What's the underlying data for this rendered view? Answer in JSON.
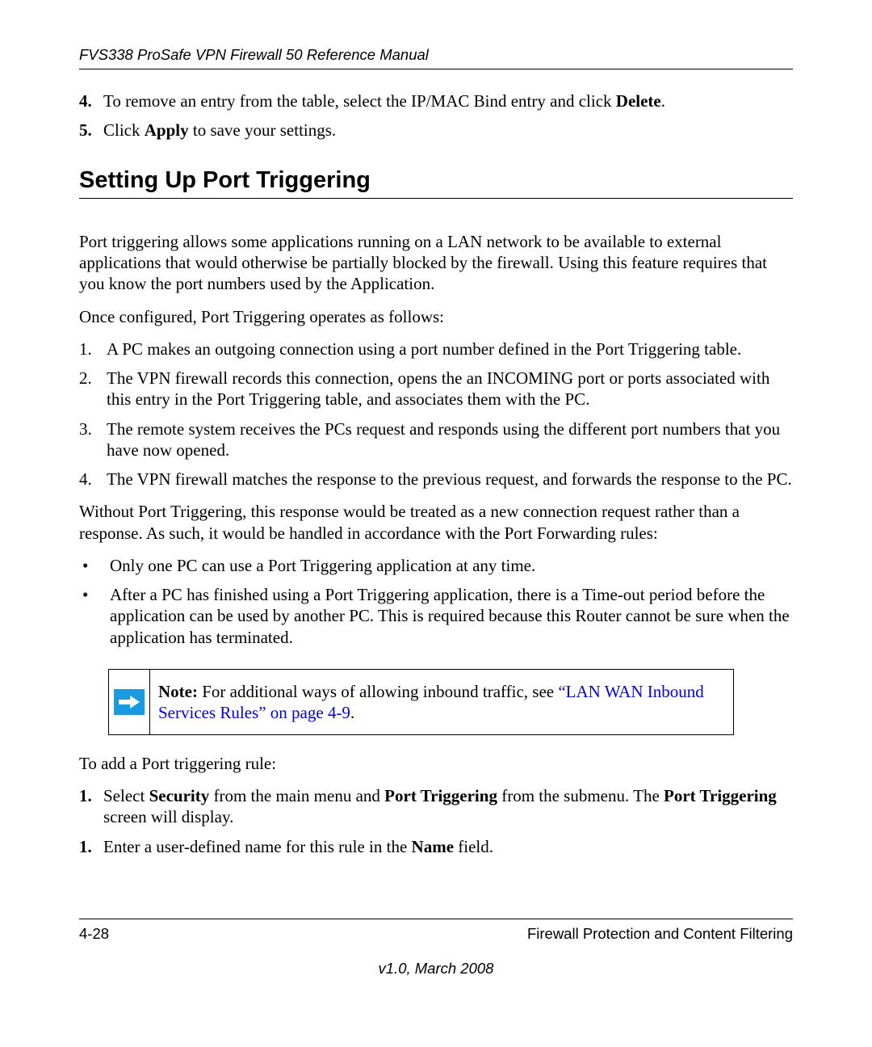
{
  "header": {
    "title": "FVS338 ProSafe VPN Firewall 50 Reference Manual"
  },
  "steps_top": [
    {
      "num": "4.",
      "pre": "To remove an entry from the table, select the IP/MAC Bind entry and click ",
      "bold": "Delete",
      "post": "."
    },
    {
      "num": "5.",
      "pre": "Click ",
      "bold": "Apply",
      "post": " to save your settings."
    }
  ],
  "section": {
    "title": "Setting Up Port Triggering"
  },
  "para1": "Port triggering allows some applications running on a LAN network to be available to external applications that would otherwise be partially blocked by the firewall. Using this feature requires that you know the port numbers used by the Application.",
  "para2": "Once configured, Port Triggering operates as follows:",
  "operates_list": [
    {
      "num": "1.",
      "text": "A PC makes an outgoing connection using a port number defined in the Port Triggering table."
    },
    {
      "num": "2.",
      "text": "The VPN firewall records this connection, opens the an INCOMING port or ports associated with this entry in the Port Triggering table, and associates them with the PC."
    },
    {
      "num": "3.",
      "text": "The remote system receives the PCs request and responds using the different port numbers that you have now opened."
    },
    {
      "num": "4.",
      "text": "The VPN firewall matches the response to the previous request, and forwards the response to the PC."
    }
  ],
  "para3": "Without Port Triggering, this response would be treated as a new connection request rather than a response. As such, it would be handled in accordance with the Port Forwarding rules:",
  "bullets": [
    "Only one PC can use a Port Triggering application at any time.",
    "After a PC has finished using a Port Triggering application, there is a Time-out period before the application can be used by another PC. This is required because this Router cannot be sure when the application has terminated."
  ],
  "note": {
    "label": "Note:",
    "text": " For additional ways of allowing inbound traffic, see ",
    "link": "“LAN WAN Inbound Services Rules” on page 4-9",
    "post": "."
  },
  "para4": "To add a Port triggering rule:",
  "steps_bottom": [
    {
      "num": "1.",
      "parts": [
        {
          "t": "Select ",
          "b": false
        },
        {
          "t": "Security",
          "b": true
        },
        {
          "t": " from the main menu and ",
          "b": false
        },
        {
          "t": "Port Triggering",
          "b": true
        },
        {
          "t": " from the submenu. The ",
          "b": false
        },
        {
          "t": "Port Triggering",
          "b": true
        },
        {
          "t": " screen will display.",
          "b": false
        }
      ]
    },
    {
      "num": "1.",
      "parts": [
        {
          "t": "Enter a user-defined name for this rule in the ",
          "b": false
        },
        {
          "t": "Name",
          "b": true
        },
        {
          "t": " field.",
          "b": false
        }
      ]
    }
  ],
  "footer": {
    "page": "4-28",
    "chapter": "Firewall Protection and Content Filtering",
    "version": "v1.0, March 2008"
  }
}
